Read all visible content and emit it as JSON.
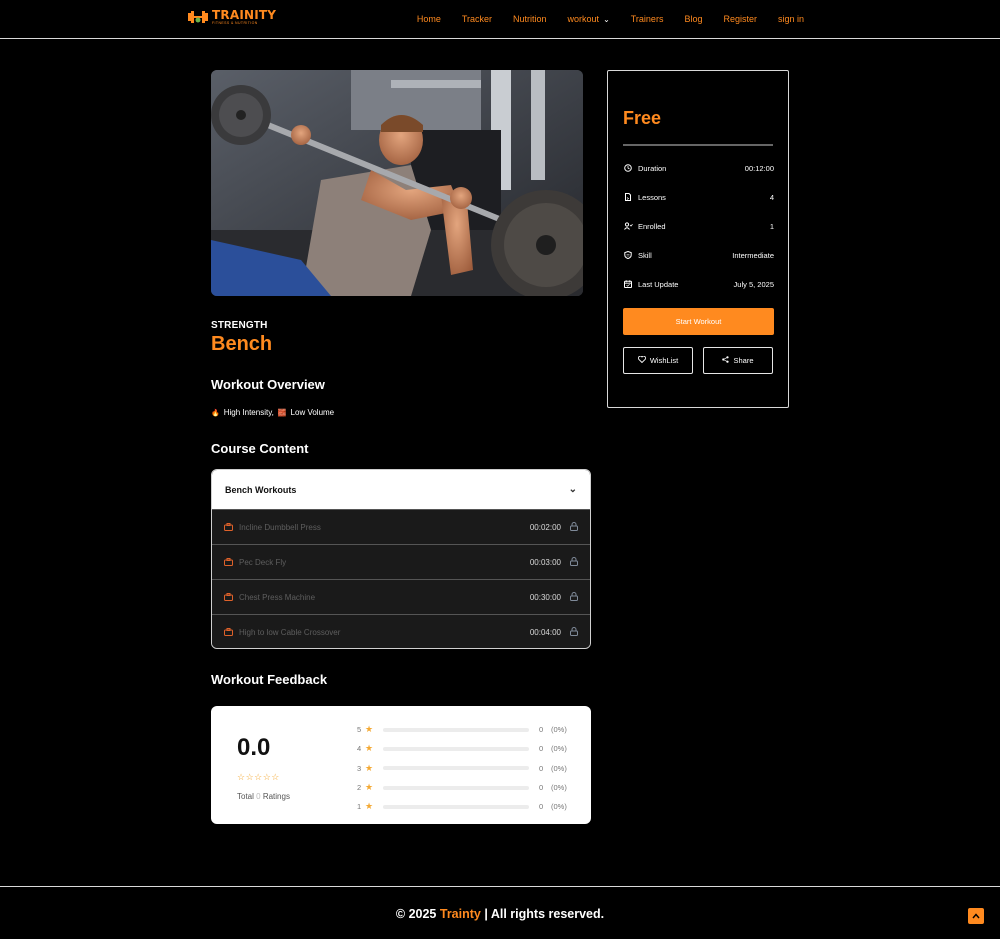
{
  "brand": {
    "logo_main": "TRAINITY",
    "logo_sub": "FITNESS & NUTRITION",
    "accent": "#ff8a1f"
  },
  "nav": {
    "home": "Home",
    "tracker": "Tracker",
    "nutrition": "Nutrition",
    "workout": "workout",
    "trainers": "Trainers",
    "blog": "Blog",
    "register": "Register",
    "signin": "sign in"
  },
  "course": {
    "category": "STRENGTH",
    "title": "Bench",
    "overview_heading": "Workout Overview",
    "tag_1": "High Intensity,",
    "tag_2": "Low Volume",
    "content_heading": "Course Content",
    "section_title": "Bench Workouts",
    "lessons": [
      {
        "name": "Incline Dumbbell Press",
        "duration": "00:02:00"
      },
      {
        "name": "Pec Deck Fly",
        "duration": "00:03:00"
      },
      {
        "name": "Chest Press Machine",
        "duration": "00:30:00"
      },
      {
        "name": "High to low Cable Crossover",
        "duration": "00:04:00"
      }
    ]
  },
  "feedback": {
    "heading": "Workout Feedback",
    "score": "0.0",
    "stars": "☆☆☆☆☆",
    "total_prefix": "Total",
    "total_count": "0",
    "total_suffix": "Ratings",
    "rows": [
      {
        "star": "5",
        "count": "0",
        "pct": "(0%)",
        "fraction": 0
      },
      {
        "star": "4",
        "count": "0",
        "pct": "(0%)",
        "fraction": 0
      },
      {
        "star": "3",
        "count": "0",
        "pct": "(0%)",
        "fraction": 0
      },
      {
        "star": "2",
        "count": "0",
        "pct": "(0%)",
        "fraction": 0
      },
      {
        "star": "1",
        "count": "0",
        "pct": "(0%)",
        "fraction": 0
      }
    ]
  },
  "sidebar": {
    "price": "Free",
    "meta": [
      {
        "icon": "clock-icon",
        "label": "Duration",
        "value": "00:12:00"
      },
      {
        "icon": "file-icon",
        "label": "Lessons",
        "value": "4"
      },
      {
        "icon": "users-icon",
        "label": "Enrolled",
        "value": "1"
      },
      {
        "icon": "shield-icon",
        "label": "Skill",
        "value": "Intermediate"
      },
      {
        "icon": "calendar-icon",
        "label": "Last Update",
        "value": "July 5, 2025"
      }
    ],
    "start_label": "Start Workout",
    "wishlist_label": "WishList",
    "share_label": "Share"
  },
  "footer": {
    "prefix": "© 2025",
    "brand": "Trainty",
    "suffix": "| All rights reserved."
  }
}
